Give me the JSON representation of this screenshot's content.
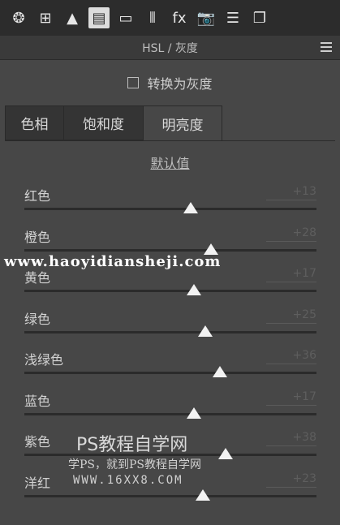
{
  "toolbar": {
    "icons": [
      {
        "name": "aperture-icon",
        "glyph": "❂"
      },
      {
        "name": "grid-icon",
        "glyph": "⊞"
      },
      {
        "name": "mountain-icon",
        "glyph": "▲"
      },
      {
        "name": "hsl-icon",
        "glyph": "▤"
      },
      {
        "name": "split-tone-icon",
        "glyph": "▭"
      },
      {
        "name": "lens-icon",
        "glyph": "⦀"
      },
      {
        "name": "fx-icon",
        "glyph": "fx"
      },
      {
        "name": "camera-icon",
        "glyph": "📷"
      },
      {
        "name": "presets-icon",
        "glyph": "☰"
      },
      {
        "name": "snapshot-icon",
        "glyph": "❐"
      }
    ]
  },
  "panel": {
    "title": "HSL / 灰度",
    "grayscale_label": "转换为灰度",
    "tabs": [
      "色相",
      "饱和度",
      "明亮度"
    ],
    "default_label": "默认值"
  },
  "sliders": [
    {
      "label": "红色",
      "value": "+13",
      "level": 0.57
    },
    {
      "label": "橙色",
      "value": "+28",
      "level": 0.64
    },
    {
      "label": "黄色",
      "value": "+17",
      "level": 0.58
    },
    {
      "label": "绿色",
      "value": "+25",
      "level": 0.62
    },
    {
      "label": "浅绿色",
      "value": "+36",
      "level": 0.67
    },
    {
      "label": "蓝色",
      "value": "+17",
      "level": 0.58
    },
    {
      "label": "紫色",
      "value": "+38",
      "level": 0.69
    },
    {
      "label": "洋红",
      "value": "+23",
      "level": 0.61
    }
  ],
  "watermark": {
    "url": "www.haoyidiansheji.com",
    "title": "PS教程自学网",
    "sub": "学PS，就到PS教程自学网",
    "domain": "WWW.16XX8.COM"
  }
}
